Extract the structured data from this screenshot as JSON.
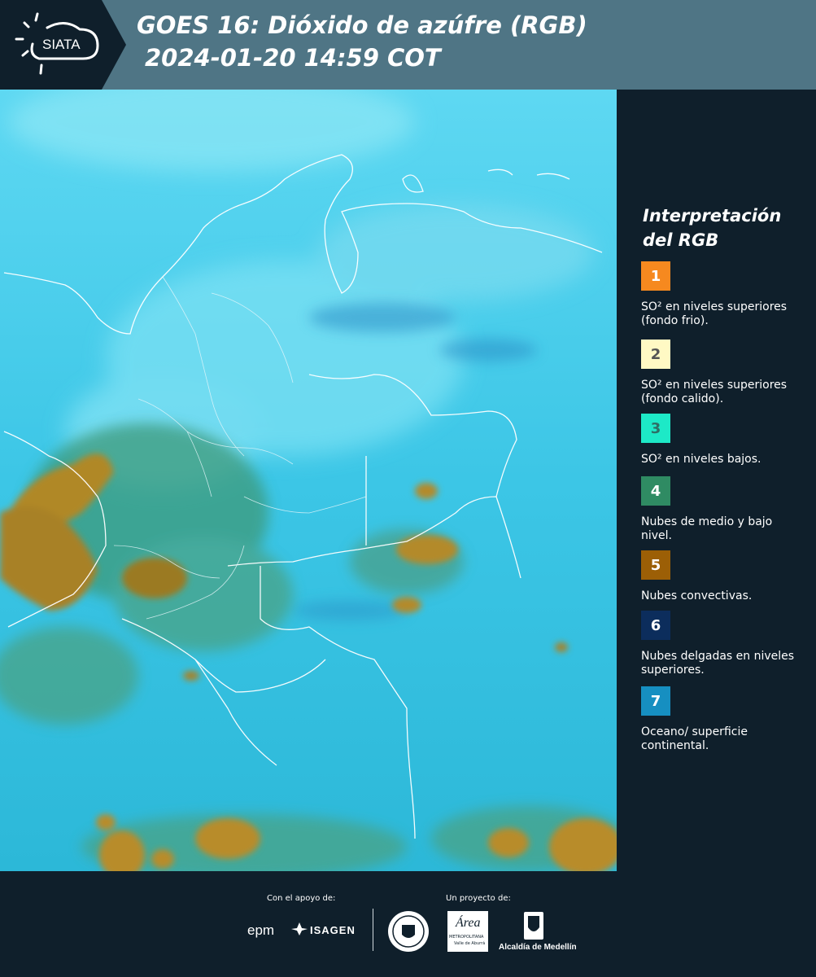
{
  "header": {
    "logo_text": "SIATA",
    "title_line1": "GOES 16: Dióxido de azúfre (RGB)",
    "title_line2": "2024-01-20 14:59 COT"
  },
  "legend": {
    "title": "Interpretación del RGB",
    "items": [
      {
        "number": "1",
        "color": "#f6891f",
        "number_color": "#ffffff",
        "label": "SO² en niveles superiores (fondo frio)."
      },
      {
        "number": "2",
        "color": "#fff9c4",
        "number_color": "#555555",
        "label": "SO² en niveles superiores (fondo calido)."
      },
      {
        "number": "3",
        "color": "#1de9c7",
        "number_color": "#2e6f66",
        "label": "SO² en niveles bajos."
      },
      {
        "number": "4",
        "color": "#2f8b63",
        "number_color": "#ffffff",
        "label": "Nubes de medio y bajo nivel."
      },
      {
        "number": "5",
        "color": "#9c5f06",
        "number_color": "#ffffff",
        "label": "Nubes convectivas."
      },
      {
        "number": "6",
        "color": "#0c2d5c",
        "number_color": "#ffffff",
        "label": "Nubes delgadas en niveles superiores."
      },
      {
        "number": "7",
        "color": "#168fc1",
        "number_color": "#ffffff",
        "label": "Oceano/ superficie continental."
      }
    ]
  },
  "footer": {
    "support_label": "Con el apoyo de:",
    "support_logos": [
      "epm",
      "ISAGEN"
    ],
    "project_label": "Un proyecto de:",
    "area_logo_text": "Área",
    "area_sub1": "METROPOLITANA",
    "area_sub2": "Valle de Aburrá",
    "alcaldia_text": "Alcaldía de Medellín"
  }
}
